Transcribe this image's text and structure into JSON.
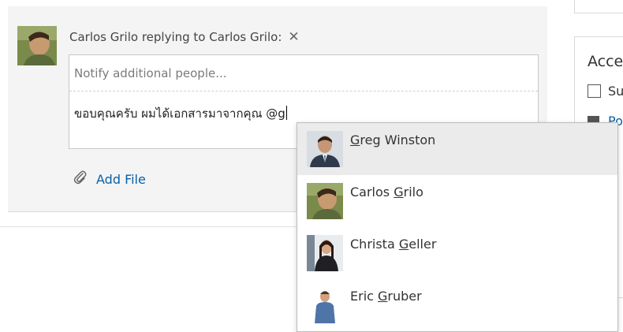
{
  "reply": {
    "header": "Carlos Grilo replying to Carlos Grilo:",
    "notify_placeholder": "Notify additional people...",
    "message": "ขอบคุณครับ ผมได้เอกสารมาจากคุณ @g",
    "add_file": "Add File"
  },
  "side_panel": {
    "title": "Acce",
    "check1_label": "Su",
    "check2_label": "Po"
  },
  "mention_suggestions": [
    {
      "pre": "",
      "match": "G",
      "post": "reg Winston",
      "avatar": "person-greg-avatar",
      "selected": true
    },
    {
      "pre": "Carlos ",
      "match": "G",
      "post": "rilo",
      "avatar": "person-carlos-avatar",
      "selected": false
    },
    {
      "pre": "Christa ",
      "match": "G",
      "post": "eller",
      "avatar": "person-christa-avatar",
      "selected": false
    },
    {
      "pre": "Eric ",
      "match": "G",
      "post": "ruber",
      "avatar": "person-eric-avatar",
      "selected": false
    }
  ],
  "colors": {
    "accent": "#0072c6",
    "link": "#0a5fa8",
    "panel_bg": "#f4f4f4",
    "selected_bg": "#ebebeb"
  }
}
